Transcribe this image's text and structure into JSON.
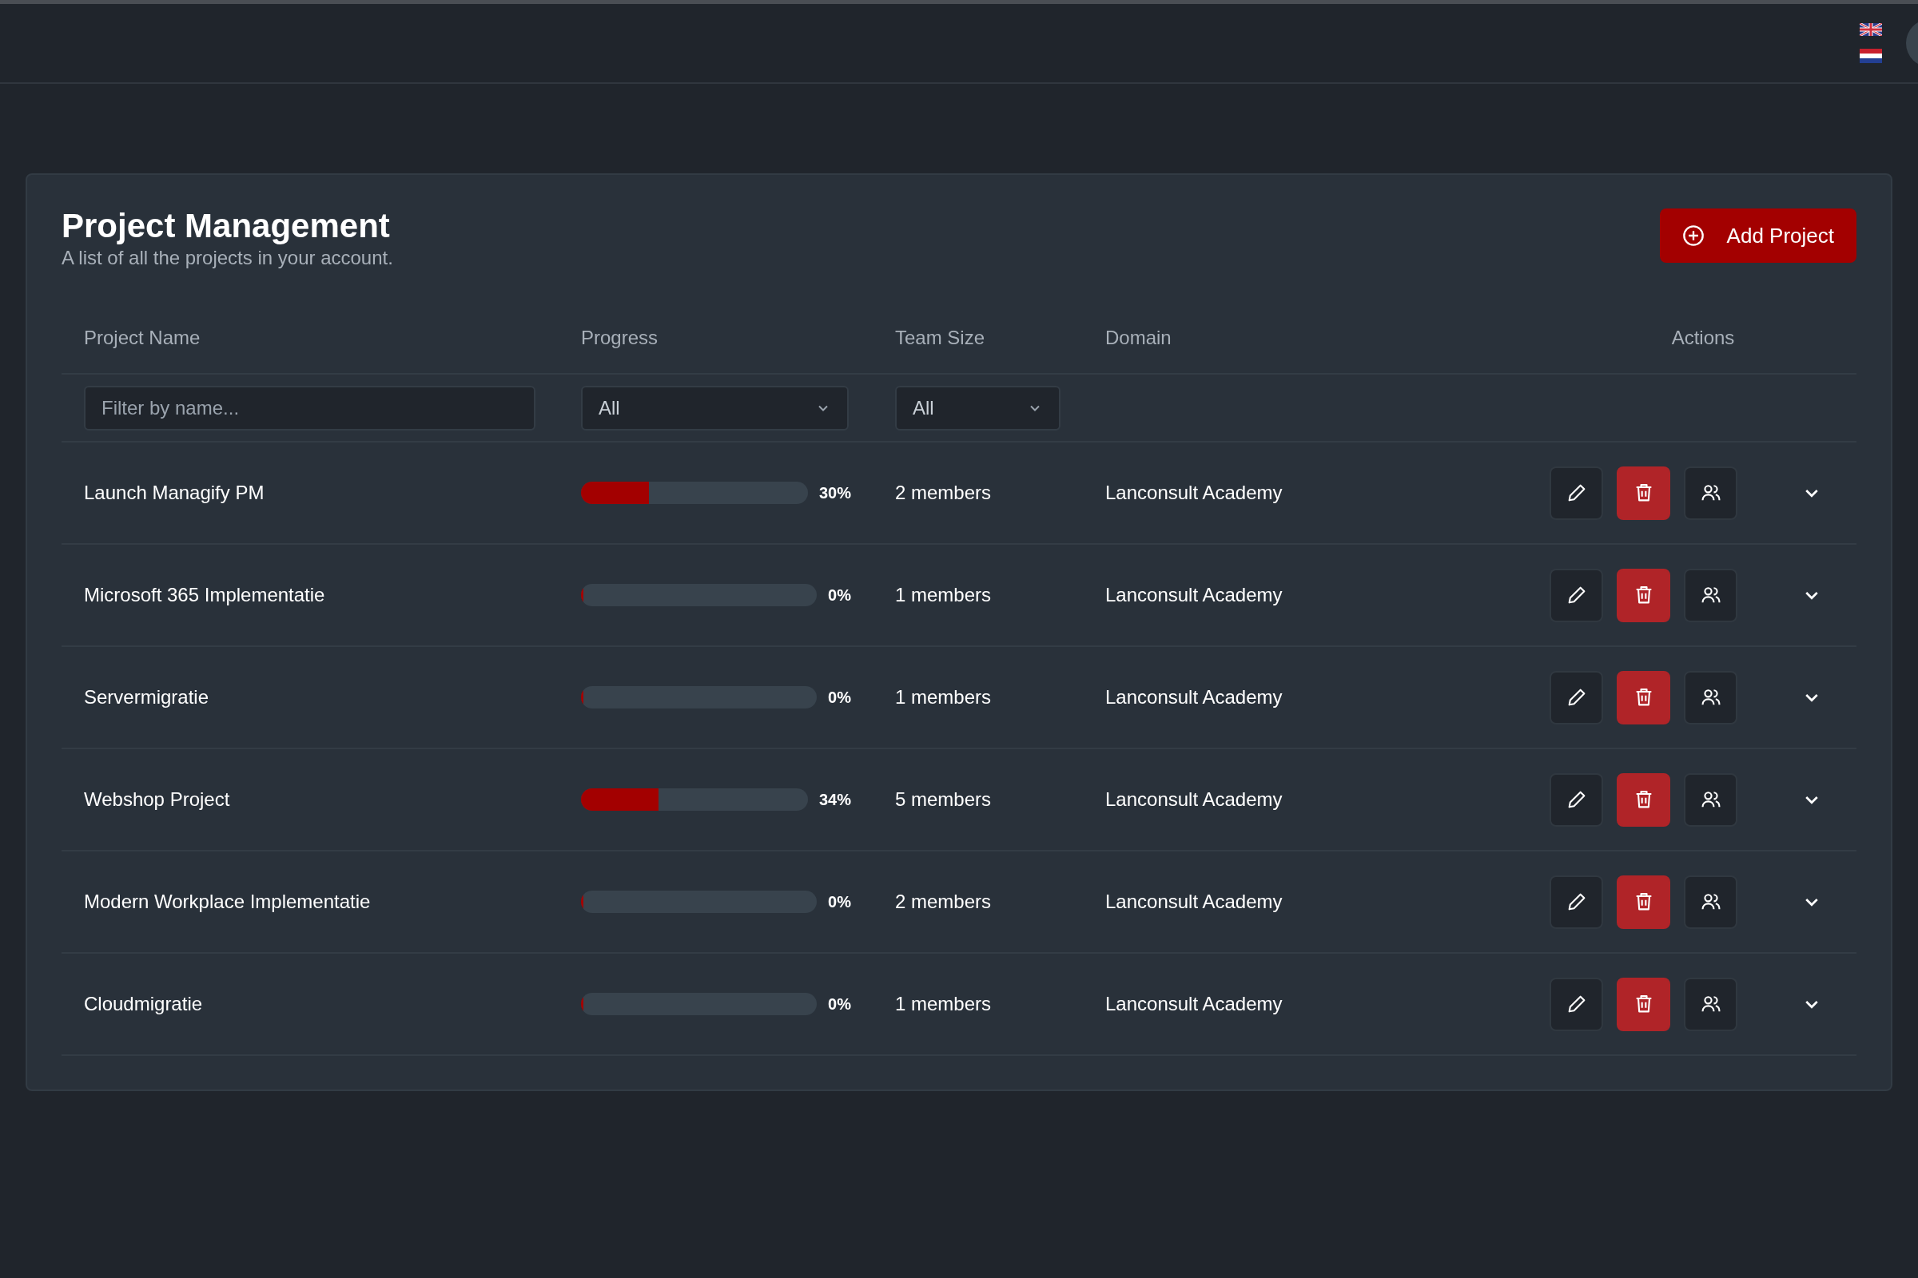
{
  "header": {
    "languages": [
      {
        "kind": "uk"
      },
      {
        "kind": "nl"
      }
    ]
  },
  "page": {
    "title": "Project Management",
    "subtitle": "A list of all the projects in your account.",
    "add_button": "Add Project"
  },
  "table": {
    "columns": [
      "Project Name",
      "Progress",
      "Team Size",
      "Domain",
      "Actions"
    ],
    "filters": {
      "name": {
        "placeholder": "Filter by name..."
      },
      "progress": "All",
      "team_size": "All"
    },
    "rows": [
      {
        "name": "Launch Managify PM",
        "level": 0.3,
        "progress": "30%",
        "team": "2 members",
        "domain": "Lanconsult Academy"
      },
      {
        "name": "Microsoft 365 Implementatie",
        "level": 0,
        "progress": "0%",
        "team": "1 members",
        "domain": "Lanconsult Academy"
      },
      {
        "name": "Servermigratie",
        "level": 0,
        "progress": "0%",
        "team": "1 members",
        "domain": "Lanconsult Academy"
      },
      {
        "name": "Webshop Project",
        "level": 0.34,
        "progress": "34%",
        "team": "5 members",
        "domain": "Lanconsult Academy"
      },
      {
        "name": "Modern Workplace Implementatie",
        "level": 0,
        "progress": "0%",
        "team": "2 members",
        "domain": "Lanconsult Academy"
      },
      {
        "name": "Cloudmigratie",
        "level": 0,
        "progress": "0%",
        "team": "1 members",
        "domain": "Lanconsult Academy"
      }
    ]
  }
}
